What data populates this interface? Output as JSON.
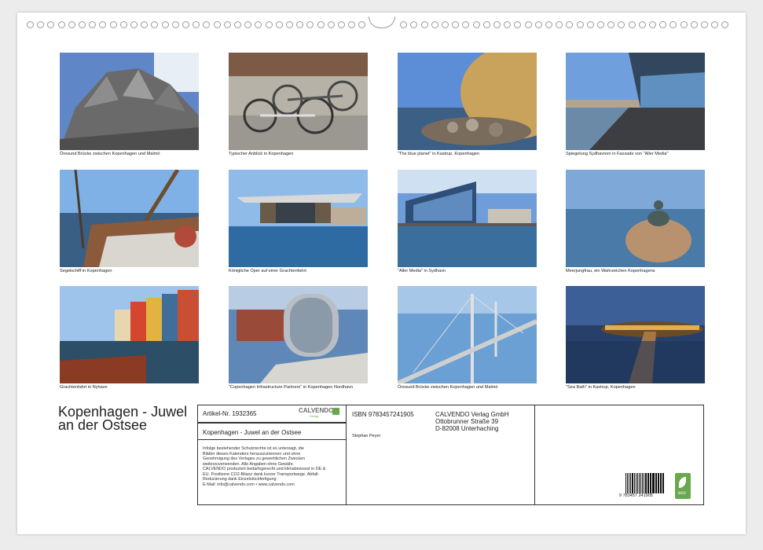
{
  "calendar": {
    "title": "Kopenhagen - Juwel an der Ostsee"
  },
  "photos": [
    {
      "caption": "Öresund Brücke zwischen Kopenhagen und Malmö"
    },
    {
      "caption": "Typischer Anblick in Kopenhagen"
    },
    {
      "caption": "\"The blue planet\" in Kastrup, Kopenhagen"
    },
    {
      "caption": "Spiegelung Sydhavnen in Fassade von \"Aller Media\""
    },
    {
      "caption": "Segelschiff in Kopenhagen"
    },
    {
      "caption": "Königliche Oper auf einer Grachtenfahrt"
    },
    {
      "caption": "\"Aller Media\" in Sydhavn"
    },
    {
      "caption": "Meerjungfrau, ein Wahrzeichen Kopenhagens"
    },
    {
      "caption": "Grachtenfahrt in Nyhavn"
    },
    {
      "caption": "\"Copenhagen Infrastructure Partners\" in Kopenhagen Nordhavn"
    },
    {
      "caption": "Öresund Brücke zwischen Kopenhagen und Malmö"
    },
    {
      "caption": "\"Sea Bath\" in Kastrup, Kopenhagen"
    }
  ],
  "info": {
    "article": "Artikel-Nr. 1932365",
    "brand": "CALVENDO",
    "brand_sub": "Verlag",
    "product_title": "Kopenhagen - Juwel an der Ostsee",
    "legal": [
      "Infolge bestehender Schutzrechte ist es untersagt, die",
      "Blätter dieses Kalenders herauszutrennen und ohne",
      "Genehmigung des Verlages zu gewerblichen Zwecken",
      "weiterzuverwenden. Alle Angaben ohne Gewähr.",
      "CALVENDO produziert bedarfsgerecht und klimabewusst in DE &",
      "EU. Positivere CO2-Bilanz dank kurzer Transportwege. Abfall-",
      "Reduzierung dank Einzelstückfertigung.",
      "E-Mail: info@calvendo.com • www.calvendo.com"
    ],
    "isbn": "ISBN 9783457241905",
    "author": "Stephan Peyer",
    "publisher": "CALVENDO Verlag GmbH",
    "street": "Ottobrunner Straße 39",
    "city": "D-82008 Unterhaching",
    "barcode_text": "9 783457 241905",
    "eco_label": "eco"
  },
  "colors": {
    "brand_green": "#6aa84f",
    "frame": "#333333"
  }
}
